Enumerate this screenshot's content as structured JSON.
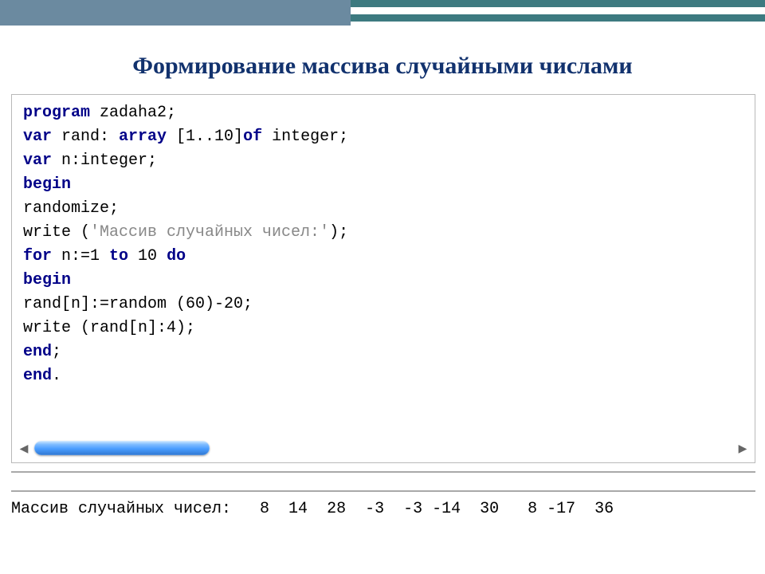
{
  "title": "Формирование массива случайными числами",
  "code": {
    "l1_kw": "program",
    "l1_rest": " zadaha2;",
    "l2_kw1": "var",
    "l2_mid": " rand: ",
    "l2_kw2": "array",
    "l2_mid2": " [1..10]",
    "l2_kw3": "of",
    "l2_rest": " integer;",
    "l3_kw": "var",
    "l3_rest": " n:integer;",
    "l4_kw": "begin",
    "l5": "randomize;",
    "l6_a": "write (",
    "l6_str": "'Массив случайных чисел:'",
    "l6_b": ");",
    "l7_kw1": "for",
    "l7_mid1": " n:=1 ",
    "l7_kw2": "to",
    "l7_mid2": " 10 ",
    "l7_kw3": "do",
    "l8_kw": "begin",
    "l9": "rand[n]:=random (60)-20;",
    "l10": "write (rand[n]:4);",
    "l11_kw": "end",
    "l11_rest": ";",
    "l12_kw": "end",
    "l12_rest": "."
  },
  "scroll": {
    "left_glyph": "◀",
    "right_glyph": "▶"
  },
  "output": "Массив случайных чисел:   8  14  28  -3  -3 -14  30   8 -17  36"
}
